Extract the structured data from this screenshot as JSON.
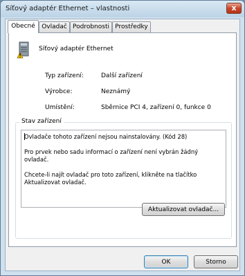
{
  "window": {
    "title": "Síťový adaptér Ethernet – vlastnosti",
    "close_label": "x"
  },
  "tabs": [
    "Obecné",
    "Ovladač",
    "Podrobnosti",
    "Prostředky"
  ],
  "device": {
    "name": "Síťový adaptér Ethernet"
  },
  "properties": [
    {
      "label": "Typ zařízení:",
      "value": "Další zařízení"
    },
    {
      "label": "Výrobce:",
      "value": "Neznámý"
    },
    {
      "label": "Umístění:",
      "value": "Sběrnice PCI 4, zařízení 0, funkce 0"
    }
  ],
  "status": {
    "legend": "Stav zařízení",
    "lines": [
      "Ovladače tohoto zařízení nejsou nainstalovány. (Kód 28)",
      "Pro prvek nebo sadu informací o zařízení není vybrán žádný ovladač.",
      "Chcete-li najít ovladač pro toto zařízení, klikněte na tlačítko Aktualizovat ovladač."
    ]
  },
  "buttons": {
    "update_driver": "Aktualizovat ovladač...",
    "ok": "OK",
    "cancel": "Storno"
  },
  "icons": {
    "device": "network-adapter-warning-icon"
  }
}
